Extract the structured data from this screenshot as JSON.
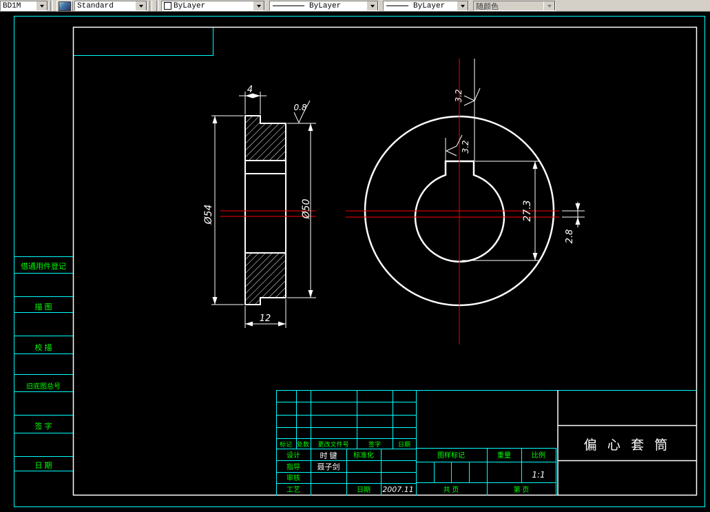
{
  "toolbar": {
    "dim_style_value": "BD1M",
    "text_style_value": "Standard",
    "color_value": "ByLayer",
    "linetype_value": "ByLayer",
    "lineweight_value": "ByLayer",
    "plot_style_value": "随颜色"
  },
  "sidebar": {
    "items": [
      "借通用件登记",
      "描  图",
      "校  描",
      "旧底图总号",
      "签  字",
      "日  期"
    ]
  },
  "dimensions": {
    "flange_width": "4",
    "roughness_body": "0.8",
    "outer_dia": "Ø54",
    "body_dia": "Ø50",
    "total_width": "12",
    "roughness_top": "3.2",
    "roughness_keyway": "3.2",
    "bore_keyway_depth": "27.3",
    "eccentric_offset": "2.8"
  },
  "title_block": {
    "part_name": "偏 心 套 筒",
    "change_header": [
      "标记",
      "处数",
      "更改文件号",
      "签字",
      "日期"
    ],
    "design_label": "设计",
    "design_name": "时 键",
    "standardization_label": "标准化",
    "advisor_label": "指导",
    "advisor_name": "聂子剑",
    "check_label": "审核",
    "process_label": "工艺",
    "date_label": "日期",
    "date_value": "2007.11",
    "mark_label": "图样标记",
    "weight_label": "重量",
    "scale_label": "比例",
    "scale_value": "1:1",
    "total_pages_label": "共  页",
    "page_label": "第  页"
  },
  "colors": {
    "border_cyan": "#00ffff",
    "label_green": "#00ff00",
    "entity_white": "#ffffff",
    "centerline_red": "#ff0000",
    "toolbar_gray": "#d4d0c8"
  }
}
